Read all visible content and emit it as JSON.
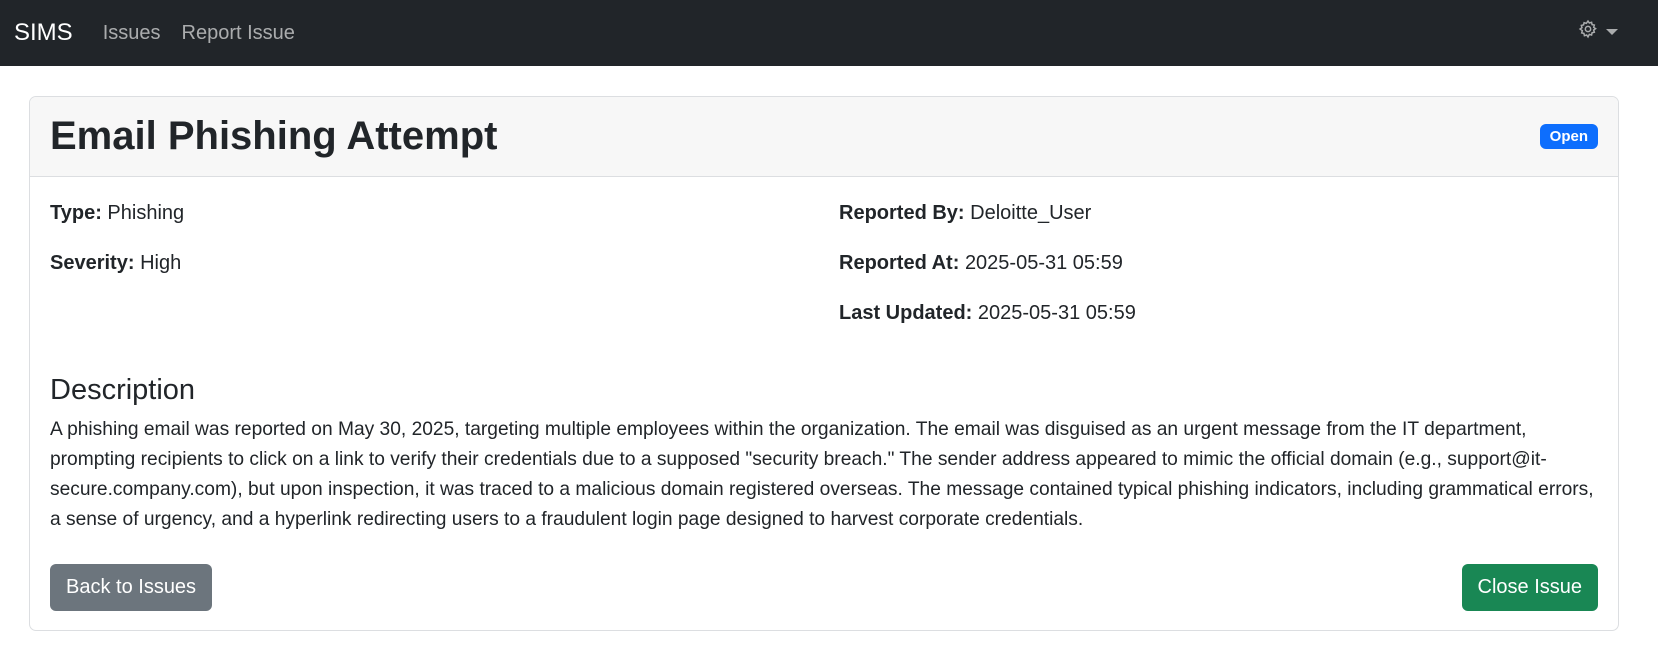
{
  "navbar": {
    "brand": "SIMS",
    "links": [
      "Issues",
      "Report Issue"
    ],
    "settings_icon": "gear-icon"
  },
  "issue": {
    "title": "Email Phishing Attempt",
    "status": "Open",
    "status_color": "#0d6efd",
    "type_label": "Type:",
    "type_value": "Phishing",
    "severity_label": "Severity:",
    "severity_value": "High",
    "reported_by_label": "Reported By:",
    "reported_by_value": "Deloitte_User",
    "reported_at_label": "Reported At:",
    "reported_at_value": "2025-05-31 05:59",
    "last_updated_label": "Last Updated:",
    "last_updated_value": "2025-05-31 05:59",
    "description_heading": "Description",
    "description": "A phishing email was reported on May 30, 2025, targeting multiple employees within the organization. The email was disguised as an urgent message from the IT department, prompting recipients to click on a link to verify their credentials due to a supposed \"security breach.\" The sender address appeared to mimic the official domain (e.g., support@it-secure.company.com), but upon inspection, it was traced to a malicious domain registered overseas. The message contained typical phishing indicators, including grammatical errors, a sense of urgency, and a hyperlink redirecting users to a fraudulent login page designed to harvest corporate credentials."
  },
  "actions": {
    "back_label": "Back to Issues",
    "close_label": "Close Issue",
    "back_color": "#6c757d",
    "close_color": "#198754"
  }
}
